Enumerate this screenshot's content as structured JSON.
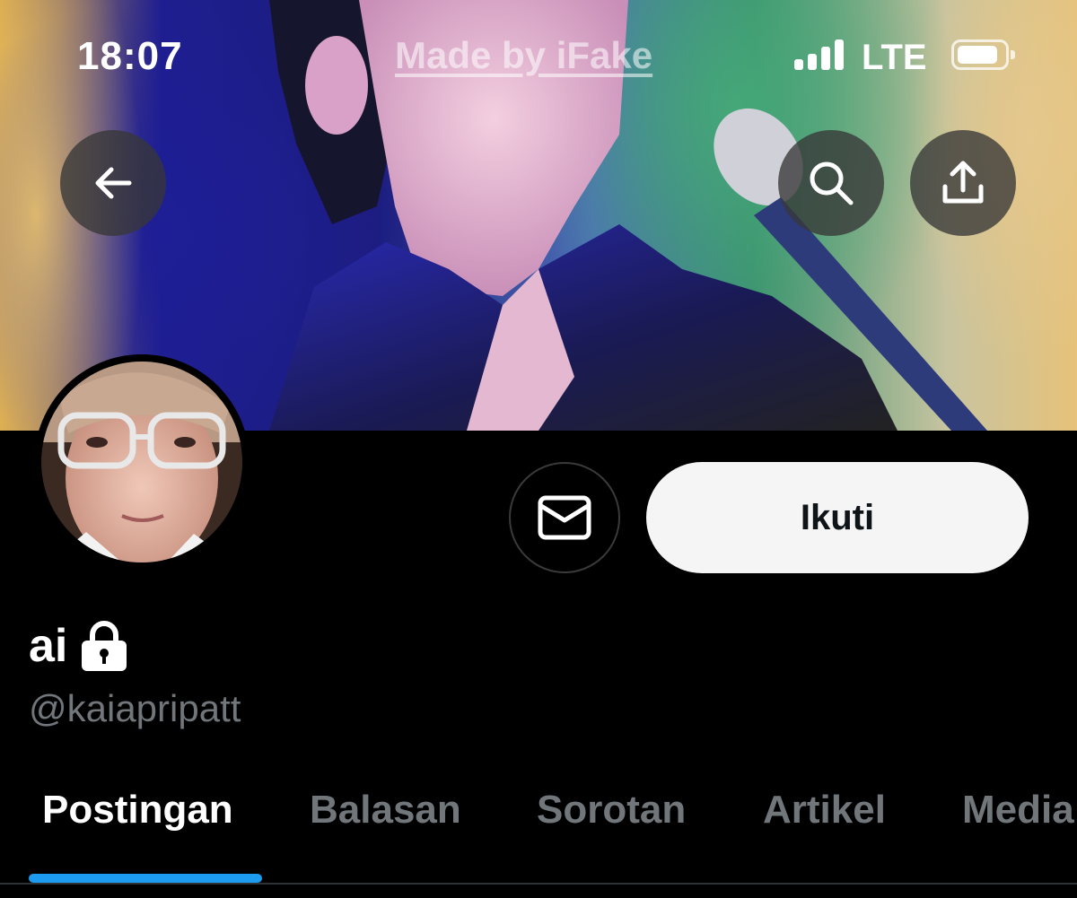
{
  "status_bar": {
    "time": "18:07",
    "watermark": "Made by iFake",
    "network": "LTE"
  },
  "header": {
    "back_icon": "arrow-left-icon",
    "search_icon": "search-icon",
    "share_icon": "share-upload-icon"
  },
  "profile": {
    "display_name": "ai",
    "protected_icon": "lock-icon",
    "handle": "@kaiapripatt",
    "message_icon": "envelope-icon",
    "follow_label": "Ikuti"
  },
  "tabs": [
    {
      "label": "Postingan",
      "active": true
    },
    {
      "label": "Balasan",
      "active": false
    },
    {
      "label": "Sorotan",
      "active": false
    },
    {
      "label": "Artikel",
      "active": false
    },
    {
      "label": "Media",
      "active": false
    }
  ],
  "colors": {
    "accent": "#1d9bf0",
    "background": "#000000",
    "muted_text": "#71767b",
    "follow_button_bg": "#f5f5f5"
  }
}
